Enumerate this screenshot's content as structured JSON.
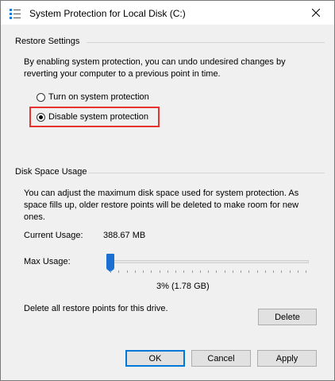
{
  "window": {
    "title": "System Protection for Local Disk (C:)"
  },
  "restore_settings": {
    "heading": "Restore Settings",
    "description_line1": "By enabling system protection, you can undo undesired changes by",
    "description_line2": "reverting your computer to a previous point in time.",
    "options": [
      {
        "label": "Turn on system protection",
        "selected": false
      },
      {
        "label": "Disable system protection",
        "selected": true
      }
    ],
    "highlight_color": "#e8322f"
  },
  "disk_space": {
    "heading": "Disk Space Usage",
    "description_line1": "You can adjust the maximum disk space used for system protection. As",
    "description_line2": "space fills up, older restore points will be deleted to make room for new",
    "description_line3": "ones.",
    "current_usage_label": "Current Usage:",
    "current_usage_value": "388.67 MB",
    "max_usage_label": "Max Usage:",
    "max_usage_value": "3% (1.78 GB)",
    "max_usage_percent": 3,
    "delete_text": "Delete all restore points for this drive.",
    "delete_button": "Delete"
  },
  "buttons": {
    "ok": "OK",
    "cancel": "Cancel",
    "apply": "Apply"
  },
  "colors": {
    "accent": "#1a6fd1",
    "default_button_border": "#0078d7"
  }
}
